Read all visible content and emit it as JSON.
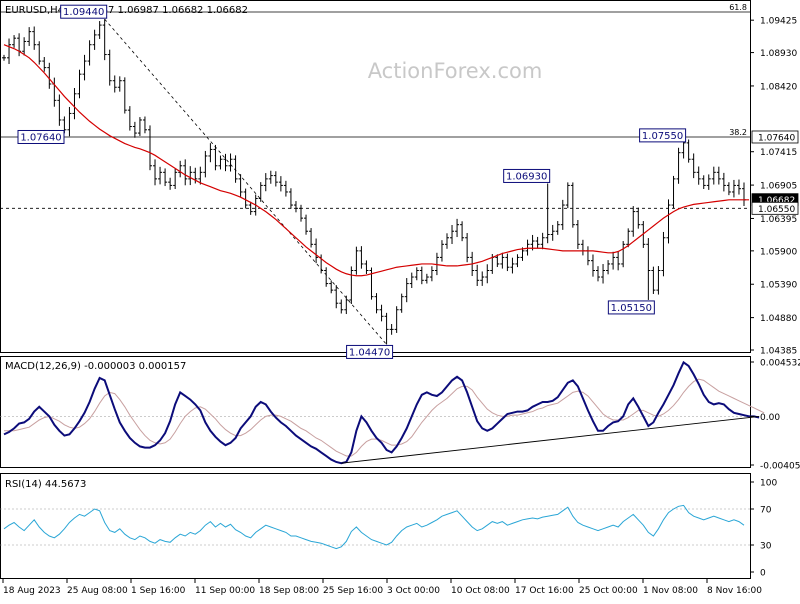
{
  "header": {
    "symbol_label": "EURUSD,H4",
    "ohlc_label": "1.06887 1.06987 1.06682 1.06682"
  },
  "watermark": "ActionForex.com",
  "colors": {
    "bar": "#000000",
    "ma": "#d40000",
    "macd": "#0c0c7a",
    "signal": "#c8a0a0",
    "rsi": "#2aa6d6",
    "current_price_tag_bg": "#000000",
    "label_border": "#0c0c7a"
  },
  "chart_data": [
    {
      "type": "candlestick",
      "panel": "price",
      "ylim": [
        1.04385,
        1.0955
      ],
      "y_ticks": [
        "1.09425",
        "1.08930",
        "1.08420",
        "1.07640",
        "1.07415",
        "1.06905",
        "1.06682",
        "1.06550",
        "1.06395",
        "1.05900",
        "1.05390",
        "1.04880",
        "1.04385"
      ],
      "x_tick_labels": [
        "18 Aug 2023",
        "25 Aug 08:00",
        "1 Sep 16:00",
        "11 Sep 00:00",
        "18 Sep 08:00",
        "25 Sep 16:00",
        "3 Oct 00:00",
        "10 Oct 08:00",
        "17 Oct 16:00",
        "25 Oct 00:00",
        "1 Nov 08:00",
        "8 Nov 16:00"
      ],
      "close_series": [
        1.0885,
        1.0905,
        1.0915,
        1.0895,
        1.091,
        1.0925,
        1.0905,
        1.088,
        1.087,
        1.0845,
        1.082,
        1.079,
        1.0775,
        1.08,
        1.083,
        1.086,
        1.088,
        1.0905,
        1.092,
        1.0935,
        1.089,
        1.085,
        1.084,
        1.085,
        1.0805,
        1.078,
        1.077,
        1.079,
        1.0775,
        1.072,
        1.07,
        1.071,
        1.0695,
        1.069,
        1.071,
        1.072,
        1.07,
        1.071,
        1.07,
        1.071,
        1.0735,
        1.0745,
        1.072,
        1.073,
        1.072,
        1.073,
        1.07,
        1.068,
        1.066,
        1.065,
        1.067,
        1.069,
        1.07,
        1.0705,
        1.0695,
        1.069,
        1.068,
        1.066,
        1.0655,
        1.064,
        1.062,
        1.06,
        1.058,
        1.056,
        1.054,
        1.053,
        1.051,
        1.05,
        1.0515,
        1.056,
        1.059,
        1.057,
        1.056,
        1.052,
        1.05,
        1.049,
        1.047,
        1.047,
        1.05,
        1.052,
        1.054,
        1.055,
        1.056,
        1.0545,
        1.055,
        1.056,
        1.058,
        1.06,
        1.061,
        1.062,
        1.063,
        1.061,
        1.058,
        1.056,
        1.0545,
        1.055,
        1.056,
        1.058,
        1.057,
        1.058,
        1.0565,
        1.057,
        1.058,
        1.059,
        1.06,
        1.0605,
        1.06,
        1.061,
        1.0615,
        1.062,
        1.063,
        1.066,
        1.069,
        1.063,
        1.06,
        1.059,
        1.0575,
        1.056,
        1.055,
        1.056,
        1.057,
        1.058,
        1.057,
        1.06,
        1.062,
        1.065,
        1.063,
        1.06,
        1.056,
        1.053,
        1.056,
        1.061,
        1.066,
        1.07,
        1.074,
        1.0755,
        1.073,
        1.071,
        1.07,
        1.069,
        1.07,
        1.071,
        1.07,
        1.069,
        1.068,
        1.069,
        1.0685,
        1.0668
      ],
      "ma_series": [
        1.0905,
        1.0902,
        1.0899,
        1.0895,
        1.089,
        1.0885,
        1.0878,
        1.087,
        1.0862,
        1.0853,
        1.0844,
        1.0835,
        1.0826,
        1.0818,
        1.081,
        1.0802,
        1.0795,
        1.0788,
        1.0782,
        1.0776,
        1.0771,
        1.0766,
        1.0762,
        1.0758,
        1.0754,
        1.0751,
        1.0748,
        1.0746,
        1.0743,
        1.074,
        1.0736,
        1.0731,
        1.0726,
        1.0721,
        1.0716,
        1.0711,
        1.0706,
        1.0702,
        1.0698,
        1.0694,
        1.0691,
        1.0688,
        1.0685,
        1.0682,
        1.068,
        1.0678,
        1.0675,
        1.0672,
        1.0668,
        1.0664,
        1.066,
        1.0655,
        1.065,
        1.0644,
        1.0638,
        1.0631,
        1.0624,
        1.0617,
        1.061,
        1.0603,
        1.0596,
        1.059,
        1.0584,
        1.0578,
        1.0572,
        1.0567,
        1.0562,
        1.0558,
        1.0555,
        1.0553,
        1.0552,
        1.0552,
        1.0553,
        1.0555,
        1.0557,
        1.0559,
        1.0561,
        1.0563,
        1.0565,
        1.0566,
        1.0567,
        1.0568,
        1.0569,
        1.057,
        1.057,
        1.057,
        1.0569,
        1.0568,
        1.0567,
        1.0567,
        1.0567,
        1.0568,
        1.0569,
        1.057,
        1.0572,
        1.0574,
        1.0577,
        1.058,
        1.0583,
        1.0586,
        1.0588,
        1.059,
        1.0592,
        1.0593,
        1.0594,
        1.0594,
        1.0594,
        1.0594,
        1.0593,
        1.0592,
        1.0591,
        1.059,
        1.059,
        1.059,
        1.059,
        1.059,
        1.059,
        1.059,
        1.0589,
        1.0588,
        1.0587,
        1.0587,
        1.0589,
        1.0593,
        1.0598,
        1.0604,
        1.061,
        1.0616,
        1.0622,
        1.0628,
        1.0634,
        1.064,
        1.0645,
        1.065,
        1.0654,
        1.0657,
        1.0659,
        1.0661,
        1.0662,
        1.0663,
        1.0664,
        1.0665,
        1.0666,
        1.0667,
        1.0668,
        1.0668,
        1.0668,
        1.0668,
        1.0668
      ],
      "horizontal_lines": [
        {
          "label": "61.8",
          "value": 1.0955,
          "style": "solid"
        },
        {
          "label": "38.2",
          "value": 1.0764,
          "style": "solid"
        },
        {
          "label": "",
          "value": 1.0655,
          "style": "dashed"
        }
      ],
      "price_tags": [
        {
          "text": "1.07640",
          "value": 1.0764,
          "style": "boxed"
        },
        {
          "text": "1.06682",
          "value": 1.06682,
          "style": "current"
        },
        {
          "text": "1.06550",
          "value": 1.0655,
          "style": "boxed"
        }
      ],
      "annotations": [
        {
          "text": "1.09440",
          "bar_index": 20,
          "value": 1.0944,
          "position": "above"
        },
        {
          "text": "1.07640",
          "bar_index": 5,
          "value": 1.0764,
          "position": "level"
        },
        {
          "text": "1.04470",
          "bar_index": 76,
          "value": 1.0447,
          "position": "below"
        },
        {
          "text": "1.06930",
          "bar_index": 108,
          "value": 1.0693,
          "position": "above"
        },
        {
          "text": "1.05150",
          "bar_index": 128,
          "value": 1.0515,
          "position": "below"
        },
        {
          "text": "1.07550",
          "bar_index": 135,
          "value": 1.0755,
          "position": "above"
        }
      ],
      "trendline": {
        "style": "dashed",
        "from": {
          "bar_index": 20,
          "value": 1.0944
        },
        "to": {
          "bar_index": 76,
          "value": 1.0447
        }
      }
    },
    {
      "type": "line",
      "panel": "macd",
      "label": "MACD(12,26,9) -0.000003 0.000157",
      "ylim": [
        -0.004051,
        0.004532
      ],
      "y_ticks": [
        "0.004532",
        "0.00",
        "-0.004051"
      ],
      "series": [
        {
          "name": "MACD",
          "values": [
            -0.0015,
            -0.0013,
            -0.001,
            -0.0006,
            -0.0005,
            -0.0002,
            0.0004,
            0.0008,
            0.0004,
            0.0,
            -0.0007,
            -0.0012,
            -0.0016,
            -0.0015,
            -0.001,
            -0.0004,
            0.0003,
            0.0012,
            0.0023,
            0.0032,
            0.003,
            0.0018,
            0.0006,
            -0.0005,
            -0.0012,
            -0.0018,
            -0.0022,
            -0.0025,
            -0.0026,
            -0.0026,
            -0.0024,
            -0.002,
            -0.0014,
            -0.0004,
            0.001,
            0.002,
            0.0017,
            0.0014,
            0.001,
            0.0005,
            -0.0005,
            -0.0012,
            -0.0017,
            -0.0021,
            -0.0024,
            -0.0022,
            -0.0018,
            -0.001,
            -0.0005,
            0.0,
            0.0008,
            0.0012,
            0.001,
            0.0004,
            -0.0001,
            -0.0005,
            -0.0008,
            -0.0012,
            -0.0016,
            -0.0019,
            -0.0022,
            -0.0025,
            -0.0027,
            -0.003,
            -0.0033,
            -0.0036,
            -0.0038,
            -0.0039,
            -0.0038,
            -0.003,
            -0.0012,
            0.0,
            -0.0005,
            -0.0012,
            -0.0018,
            -0.0022,
            -0.0028,
            -0.003,
            -0.0025,
            -0.0018,
            -0.001,
            0.0,
            0.001,
            0.0018,
            0.002,
            0.0018,
            0.0017,
            0.002,
            0.0025,
            0.003,
            0.0033,
            0.003,
            0.002,
            0.0008,
            -0.0004,
            -0.001,
            -0.0012,
            -0.001,
            -0.0006,
            -0.0002,
            0.0002,
            0.0003,
            0.0004,
            0.0004,
            0.0005,
            0.0008,
            0.001,
            0.0012,
            0.0012,
            0.0013,
            0.0016,
            0.0022,
            0.0028,
            0.003,
            0.0025,
            0.0015,
            0.0005,
            -0.0004,
            -0.0012,
            -0.0012,
            -0.0008,
            -0.0005,
            -0.0004,
            0.0,
            0.001,
            0.0015,
            0.0008,
            0.0,
            -0.0008,
            -0.0005,
            0.0003,
            0.001,
            0.0018,
            0.0026,
            0.0036,
            0.0045,
            0.0042,
            0.0035,
            0.0027,
            0.0018,
            0.0012,
            0.001,
            0.0011,
            0.001,
            0.0006,
            0.0003,
            0.0002,
            0.0001,
            0.0,
            0.0,
            -0.0001
          ]
        },
        {
          "name": "Signal",
          "values": [
            -0.0012,
            -0.0012,
            -0.0012,
            -0.0011,
            -0.001,
            -0.0009,
            -0.0006,
            -0.0003,
            -0.0001,
            0.0,
            -0.0002,
            -0.0004,
            -0.0007,
            -0.0009,
            -0.001,
            -0.0009,
            -0.0006,
            -0.0002,
            0.0004,
            0.0011,
            0.0017,
            0.002,
            0.0019,
            0.0014,
            0.0008,
            0.0001,
            -0.0005,
            -0.0011,
            -0.0016,
            -0.002,
            -0.0022,
            -0.0023,
            -0.0022,
            -0.0019,
            -0.0013,
            -0.0006,
            0.0,
            0.0004,
            0.0007,
            0.0008,
            0.0006,
            0.0002,
            -0.0002,
            -0.0007,
            -0.0011,
            -0.0014,
            -0.0016,
            -0.0016,
            -0.0014,
            -0.0011,
            -0.0007,
            -0.0003,
            0.0,
            0.0001,
            0.0001,
            0.0,
            -0.0002,
            -0.0004,
            -0.0007,
            -0.001,
            -0.0012,
            -0.0015,
            -0.0018,
            -0.002,
            -0.0023,
            -0.0026,
            -0.0029,
            -0.0031,
            -0.0033,
            -0.0033,
            -0.003,
            -0.0025,
            -0.0021,
            -0.0019,
            -0.0019,
            -0.002,
            -0.0022,
            -0.0024,
            -0.0024,
            -0.0023,
            -0.0021,
            -0.0017,
            -0.0011,
            -0.0005,
            0.0,
            0.0005,
            0.0009,
            0.0012,
            0.0015,
            0.0019,
            0.0023,
            0.0025,
            0.0025,
            0.0022,
            0.0016,
            0.0011,
            0.0006,
            0.0003,
            0.0001,
            0.0,
            0.0,
            0.0001,
            0.0001,
            0.0002,
            0.0003,
            0.0004,
            0.0006,
            0.0007,
            0.0009,
            0.001,
            0.0011,
            0.0014,
            0.0017,
            0.002,
            0.0021,
            0.002,
            0.0017,
            0.0012,
            0.0007,
            0.0002,
            -0.0001,
            -0.0003,
            -0.0003,
            -0.0003,
            -0.0001,
            0.0002,
            0.0005,
            0.0005,
            0.0003,
            0.0001,
            0.0,
            0.0002,
            0.0005,
            0.0009,
            0.0014,
            0.002,
            0.0025,
            0.0029,
            0.0031,
            0.003,
            0.0027,
            0.0024,
            0.0021,
            0.0019,
            0.0017,
            0.0015,
            0.0013,
            0.0011,
            0.0009,
            0.0007,
            0.0005,
            0.0003
          ]
        }
      ],
      "trendline": {
        "from": {
          "bar_index": 67,
          "value": -0.0039
        },
        "to": {
          "bar_index": 150,
          "value": 0.0
        }
      }
    },
    {
      "type": "line",
      "panel": "rsi",
      "label": "RSI(14) 44.5673",
      "ylim": [
        0,
        100
      ],
      "y_ticks": [
        "100",
        "70",
        "30",
        "0"
      ],
      "reference_lines": [
        70,
        30
      ],
      "series": [
        {
          "name": "RSI",
          "values": [
            48,
            52,
            55,
            50,
            46,
            52,
            58,
            50,
            44,
            40,
            38,
            42,
            48,
            55,
            60,
            64,
            62,
            66,
            70,
            68,
            55,
            46,
            44,
            48,
            42,
            38,
            36,
            40,
            38,
            34,
            32,
            36,
            34,
            33,
            38,
            42,
            40,
            44,
            42,
            46,
            52,
            56,
            50,
            54,
            50,
            53,
            47,
            44,
            40,
            38,
            44,
            48,
            52,
            50,
            48,
            46,
            44,
            40,
            40,
            38,
            36,
            34,
            33,
            32,
            30,
            28,
            26,
            28,
            34,
            45,
            50,
            44,
            40,
            36,
            34,
            32,
            30,
            33,
            40,
            46,
            50,
            52,
            54,
            50,
            52,
            55,
            58,
            62,
            64,
            66,
            68,
            62,
            56,
            50,
            46,
            48,
            52,
            56,
            54,
            56,
            52,
            54,
            56,
            58,
            59,
            60,
            59,
            61,
            62,
            63,
            64,
            68,
            72,
            62,
            55,
            52,
            50,
            48,
            46,
            48,
            50,
            52,
            50,
            56,
            60,
            64,
            58,
            52,
            44,
            40,
            48,
            58,
            66,
            70,
            73,
            74,
            66,
            62,
            60,
            58,
            60,
            62,
            60,
            58,
            56,
            58,
            56,
            52
          ]
        }
      ]
    }
  ]
}
